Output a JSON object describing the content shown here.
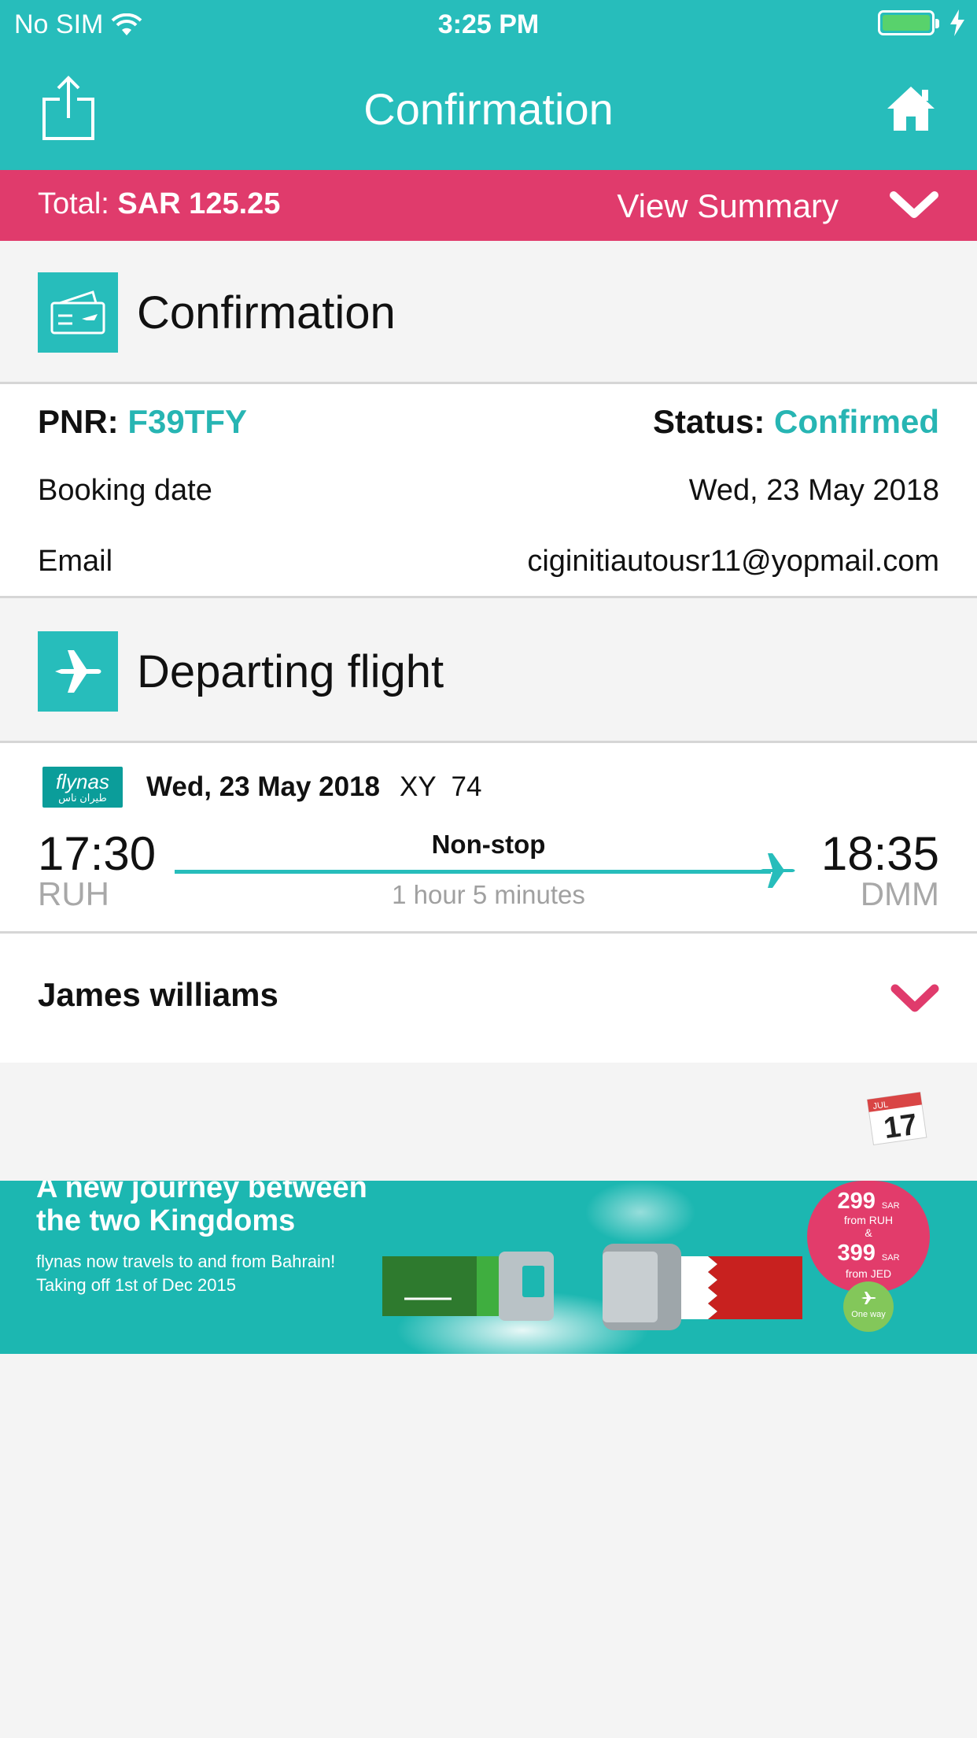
{
  "status_bar": {
    "carrier": "No SIM",
    "time": "3:25 PM"
  },
  "nav": {
    "title": "Confirmation",
    "share_icon": "share-icon",
    "home_icon": "home-icon"
  },
  "summary": {
    "total_label": "Total:",
    "total_value": "SAR 125.25",
    "view_summary": "View Summary"
  },
  "confirmation": {
    "section_title": "Confirmation",
    "pnr_label": "PNR:",
    "pnr_value": "F39TFY",
    "status_label": "Status:",
    "status_value": "Confirmed",
    "booking_date_label": "Booking date",
    "booking_date_value": "Wed, 23 May 2018",
    "email_label": "Email",
    "email_value": "ciginitiautousr11@yopmail.com"
  },
  "departing": {
    "section_title": "Departing flight",
    "airline_logo_text": "flynas",
    "airline_logo_subtext": "طيران ناس",
    "date": "Wed, 23 May 2018",
    "flight_number": "XY  74",
    "departure_time": "17:30",
    "departure_code": "RUH",
    "arrival_time": "18:35",
    "arrival_code": "DMM",
    "stops": "Non-stop",
    "duration": "1 hour 5 minutes"
  },
  "passenger": {
    "name": "James williams"
  },
  "calendar": {
    "month": "JUL",
    "day": "17"
  },
  "banner": {
    "line1": "A new journey between",
    "line2": "the two Kingdoms",
    "line3": "flynas now travels to and from Bahrain!",
    "line4": "Taking off 1st of Dec 2015",
    "price1": "299",
    "price_unit": "SAR",
    "from1": "from RUH",
    "amp": "&",
    "price2": "399",
    "from2": "from JED",
    "one_way": "One way"
  },
  "colors": {
    "teal": "#27bdbb",
    "pink": "#e03b6c",
    "background": "#f4f4f4"
  }
}
